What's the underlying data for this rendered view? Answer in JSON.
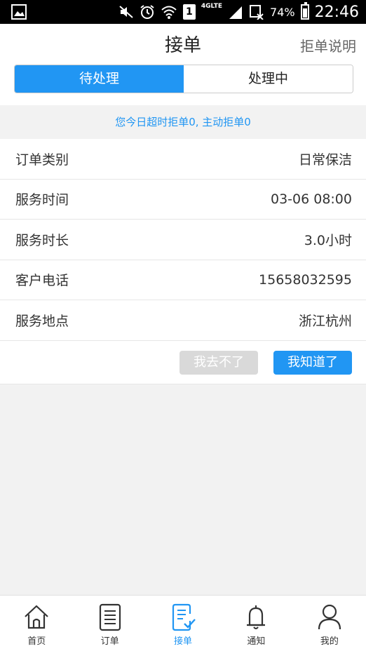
{
  "status_bar": {
    "lte": "4GLTE",
    "sim": "1",
    "battery_percent": "74%",
    "time": "22:46"
  },
  "header": {
    "title": "接单",
    "reject_info": "拒单说明"
  },
  "segments": {
    "pending": "待处理",
    "in_progress": "处理中"
  },
  "notice": "您今日超时拒单0, 主动拒单0",
  "order": {
    "rows": [
      {
        "label": "订单类别",
        "value": "日常保洁"
      },
      {
        "label": "服务时间",
        "value": "03-06 08:00"
      },
      {
        "label": "服务时长",
        "value": "3.0小时"
      },
      {
        "label": "客户电话",
        "value": "15658032595"
      },
      {
        "label": "服务地点",
        "value": "浙江杭州"
      }
    ],
    "decline_label": "我去不了",
    "accept_label": "我知道了"
  },
  "tabbar": {
    "items": [
      {
        "label": "首页",
        "icon": "home-icon"
      },
      {
        "label": "订单",
        "icon": "document-icon"
      },
      {
        "label": "接单",
        "icon": "receive-order-icon"
      },
      {
        "label": "通知",
        "icon": "bell-icon"
      },
      {
        "label": "我的",
        "icon": "person-icon"
      }
    ],
    "active_index": 2
  },
  "colors": {
    "accent": "#2196f3",
    "disabled": "#d9d9d9",
    "background": "#f2f2f2"
  }
}
